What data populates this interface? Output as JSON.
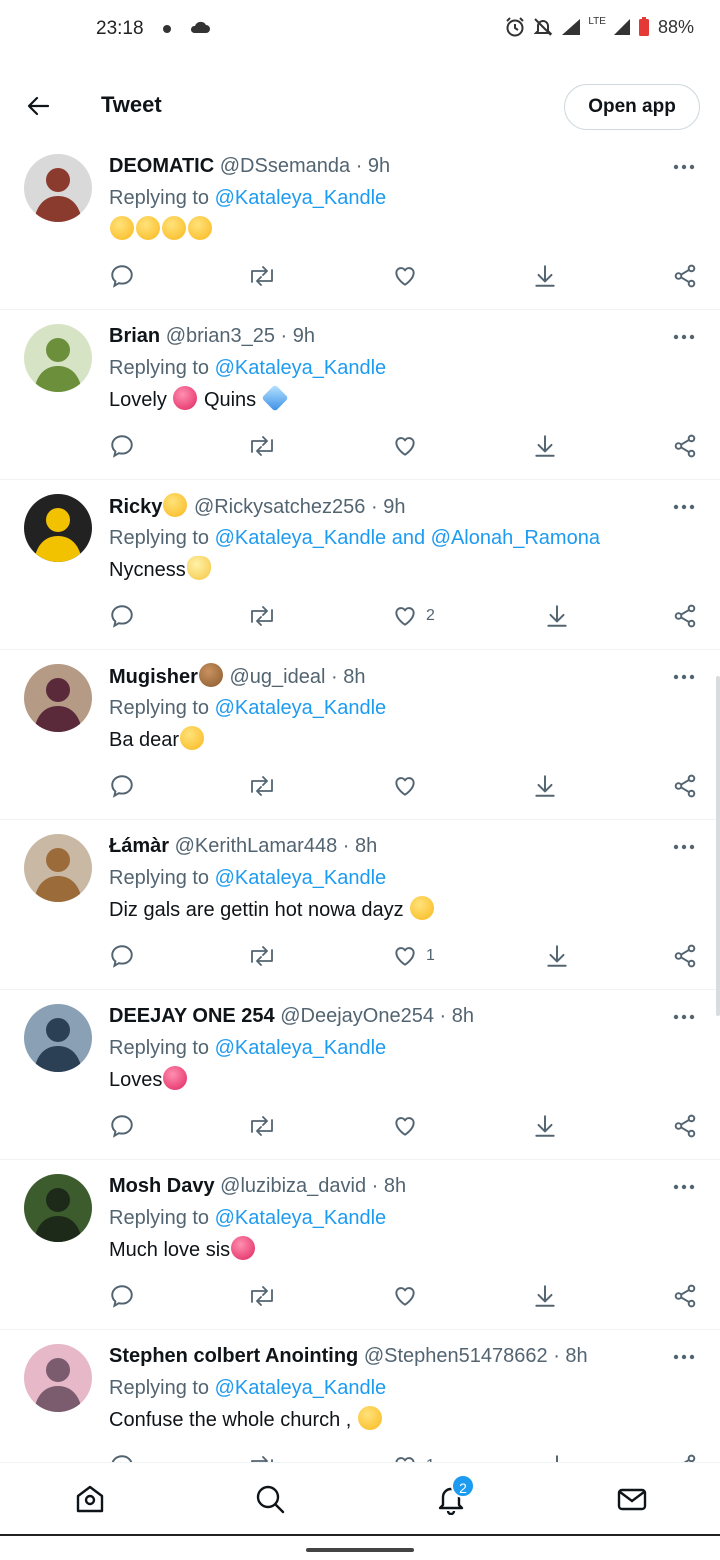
{
  "status_bar": {
    "time": "23:18",
    "battery": "88%",
    "network": "LTE"
  },
  "header": {
    "title": "Tweet",
    "open_app_label": "Open app"
  },
  "replying_prefix": "Replying to",
  "tweets": [
    {
      "name": "DEOMATIC",
      "handle": "@DSsemanda",
      "time": "9h",
      "mentions": "@Kataleya_Kandle",
      "text": "",
      "emoji_after": [
        "y",
        "y",
        "y",
        "y"
      ],
      "likes": "",
      "avatar_colors": [
        "#8b3a2e",
        "#d9d9d9"
      ]
    },
    {
      "name": "Brian",
      "handle": "@brian3_25",
      "time": "9h",
      "mentions": "@Kataleya_Kandle",
      "text": "Lovely",
      "text2": "Quins",
      "likes": "",
      "avatar_colors": [
        "#6b8f3b",
        "#d7e3c5"
      ]
    },
    {
      "name": "Ricky",
      "handle": "@Rickysatchez256",
      "time": "9h",
      "mentions": "@Kataleya_Kandle and @Alonah_Ramona",
      "text": "Nycness",
      "likes": "2",
      "avatar_colors": [
        "#f2c200",
        "#222222"
      ]
    },
    {
      "name": "Mugisher",
      "handle": "@ug_ideal",
      "time": "8h",
      "mentions": "@Kataleya_Kandle",
      "text": "Ba dear",
      "likes": "",
      "avatar_colors": [
        "#5a2a3a",
        "#b59a86"
      ]
    },
    {
      "name": "Łámàr",
      "handle": "@KerithLamar448",
      "time": "8h",
      "mentions": "@Kataleya_Kandle",
      "text": "Diz gals are gettin hot nowa dayz",
      "likes": "1",
      "avatar_colors": [
        "#9b6b3a",
        "#c9b8a4"
      ]
    },
    {
      "name": "DEEJAY ONE 254",
      "handle": "@DeejayOne254",
      "time": "8h",
      "mentions": "@Kataleya_Kandle",
      "text": "Loves",
      "likes": "",
      "avatar_colors": [
        "#2b3f55",
        "#8aa0b5"
      ]
    },
    {
      "name": "Mosh Davy",
      "handle": "@luzibiza_david",
      "time": "8h",
      "mentions": "@Kataleya_Kandle",
      "text": "Much love sis",
      "likes": "",
      "avatar_colors": [
        "#1d2a1a",
        "#3d5c2e"
      ]
    },
    {
      "name": "Stephen colbert Anointing",
      "handle": "@Stephen51478662",
      "time": "8h",
      "mentions": "@Kataleya_Kandle",
      "text": "Confuse the whole church ,",
      "likes": "1",
      "avatar_colors": [
        "#7a5c6e",
        "#e6b8c8"
      ]
    }
  ],
  "bottom_nav": {
    "notifications_badge": "2"
  },
  "colors": {
    "link": "#1d9bf0",
    "secondary_text": "#536471",
    "primary_text": "#0f1419",
    "border": "#eff3f4"
  }
}
